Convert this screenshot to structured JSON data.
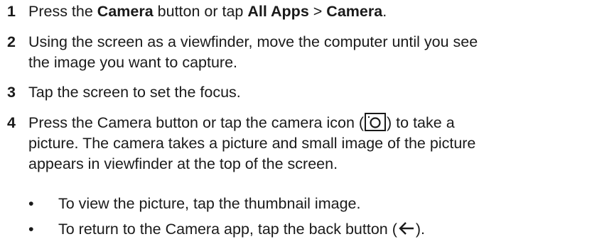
{
  "steps": [
    {
      "number": "1",
      "parts": [
        "Press the ",
        "Camera",
        " button or tap ",
        "All Apps",
        " > ",
        "Camera",
        "."
      ]
    },
    {
      "number": "2",
      "line1": "Using the screen as a viewfinder, move the computer until you see",
      "line2": "the image you want to capture."
    },
    {
      "number": "3",
      "text": "Tap the screen to set the focus."
    },
    {
      "number": "4",
      "before_icon": "Press the Camera button or tap the camera icon (",
      "after_icon": ") to take a",
      "line2": "picture. The camera takes a picture and small image of the picture",
      "line3": "appears in viewfinder at the top of the screen."
    }
  ],
  "bullets": [
    {
      "symbol": "•",
      "text": "To view the picture, tap the thumbnail image."
    },
    {
      "symbol": "•",
      "before_icon": "To return to the Camera app, tap the back button (",
      "after_icon": ")."
    }
  ],
  "icons": {
    "camera": "camera-icon",
    "back": "back-arrow-icon"
  }
}
